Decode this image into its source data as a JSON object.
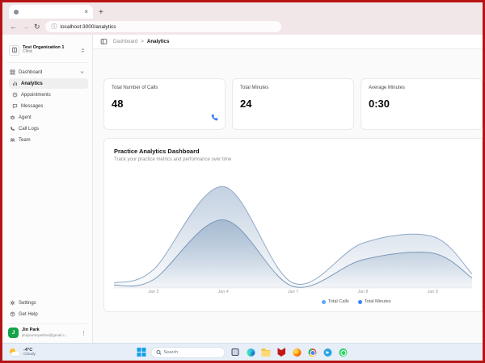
{
  "colors": {
    "frame": "#b61414",
    "accent": "#3b82f6",
    "avatar_green": "#16a34a"
  },
  "browser": {
    "tab_title": "",
    "close_label": "×",
    "new_tab_label": "+",
    "url": "localhost:3000/analytics",
    "icons": [
      "back-arrow",
      "forward-arrow",
      "refresh",
      "site-info"
    ]
  },
  "header": {
    "breadcrumb": {
      "parent": "Dashboard",
      "separator": ">",
      "current": "Analytics"
    }
  },
  "sidebar": {
    "org": {
      "name": "Test Organization 1",
      "type": "Clinic"
    },
    "menu": {
      "dashboard": "Dashboard",
      "analytics": "Analytics",
      "appointments": "Appointments",
      "messages": "Messages",
      "agent": "Agent",
      "call_logs": "Call Logs",
      "team": "Team"
    },
    "footer": {
      "settings": "Settings",
      "help": "Get Help"
    },
    "user": {
      "initial": "J",
      "name": "Jin Park",
      "email": "jinsjourneywithai@gmail.c...",
      "menu": "⋮"
    },
    "icons": [
      "building",
      "chevrons-up-down",
      "grid",
      "bar-chart",
      "clock",
      "message",
      "bot",
      "phone",
      "users",
      "gear",
      "help-circle",
      "ellipsis-vertical"
    ]
  },
  "cards": [
    {
      "label": "Total Number of Calls",
      "value": "48"
    },
    {
      "label": "Total Minutes",
      "value": "24"
    },
    {
      "label": "Average Minutes",
      "value": "0:30"
    }
  ],
  "section": {
    "title": "Practice Analytics Dashboard",
    "subtitle": "Track your practice metrics and performance over time"
  },
  "chart_data": {
    "type": "area",
    "title": "Practice Analytics Dashboard",
    "x": [
      "Jan 3",
      "Jan 4",
      "Jan 7",
      "Jan 8",
      "Jan 9"
    ],
    "series": [
      {
        "name": "Total Calls",
        "values": [
          5,
          30,
          1,
          13,
          15
        ],
        "color": "#8fa8c6",
        "dot": "#60a5fa",
        "fill": "#b9c9dc"
      },
      {
        "name": "Total Minutes",
        "values": [
          2,
          20,
          0,
          8,
          10
        ],
        "color": "#7b97b8",
        "dot": "#3b82f6",
        "fill": "#9db4cd"
      }
    ],
    "ylim": [
      0,
      32
    ],
    "grid": false,
    "legend_position": "bottom-right"
  },
  "taskbar": {
    "weather": {
      "temp": "-4°C",
      "condition": "Cloudy"
    },
    "search_placeholder": "Search",
    "icons": [
      "task-view",
      "edge",
      "file-explorer",
      "mcafee",
      "firefox",
      "chrome",
      "telegram",
      "whatsapp"
    ]
  }
}
